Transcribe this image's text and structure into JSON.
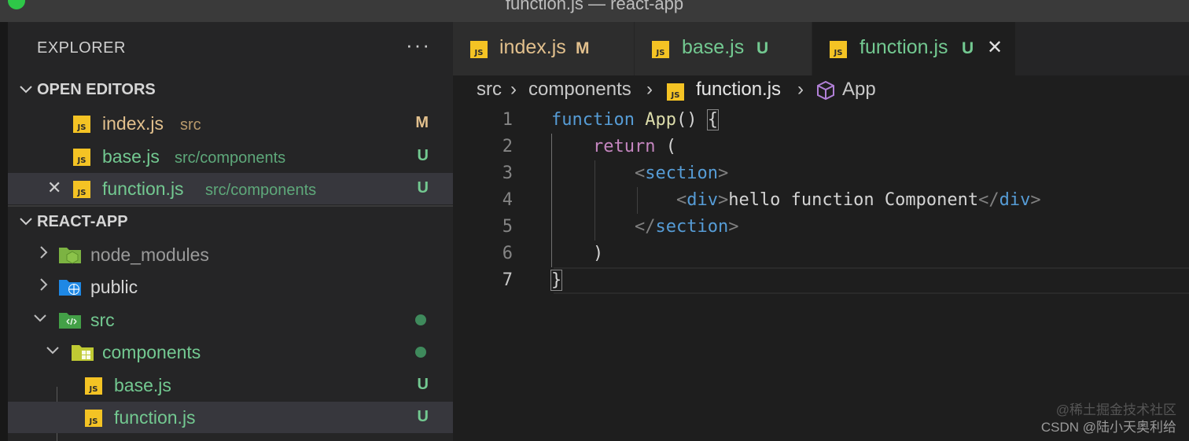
{
  "window": {
    "title": "function.js — react-app"
  },
  "sidebar": {
    "header": "EXPLORER",
    "more": "···",
    "open_editors": {
      "title": "OPEN EDITORS",
      "items": [
        {
          "name": "index.js",
          "path": "src",
          "status": "M"
        },
        {
          "name": "base.js",
          "path": "src/components",
          "status": "U"
        },
        {
          "name": "function.js",
          "path": "src/components",
          "status": "U"
        }
      ]
    },
    "project": {
      "title": "REACT-APP",
      "items": [
        {
          "name": "node_modules"
        },
        {
          "name": "public"
        },
        {
          "name": "src"
        },
        {
          "name": "components"
        },
        {
          "name": "base.js",
          "status": "U"
        },
        {
          "name": "function.js",
          "status": "U"
        }
      ]
    }
  },
  "tabs": [
    {
      "name": "index.js",
      "status": "M"
    },
    {
      "name": "base.js",
      "status": "U"
    },
    {
      "name": "function.js",
      "status": "U"
    }
  ],
  "breadcrumb": [
    "src",
    "components",
    "function.js",
    "App"
  ],
  "code": {
    "line_numbers": [
      "1",
      "2",
      "3",
      "4",
      "5",
      "6",
      "7"
    ],
    "l1": {
      "kw": "function",
      "fn": "App",
      "rest": "() ",
      "brace": "{"
    },
    "l2": {
      "kw": "return",
      "rest": " ("
    },
    "l3": {
      "open": "<",
      "tag": "section",
      "close": ">"
    },
    "l4": {
      "open": "<",
      "tag": "div",
      "close": ">",
      "text": "hello function Component",
      "open2": "</",
      "tag2": "div",
      "close2": ">"
    },
    "l5": {
      "open": "</",
      "tag": "section",
      "close": ">"
    },
    "l6": {
      "rest": ")"
    },
    "l7": {
      "brace": "}"
    }
  },
  "watermark": {
    "line1": "@稀土掘金技术社区",
    "line2": "CSDN @陆小天奥利给"
  },
  "colors": {
    "modified": "#e2c08d",
    "untracked": "#73c991",
    "js_icon": "#f4c324",
    "keyword": "#569cd6",
    "control": "#c586c0",
    "function": "#dcdcaa"
  }
}
